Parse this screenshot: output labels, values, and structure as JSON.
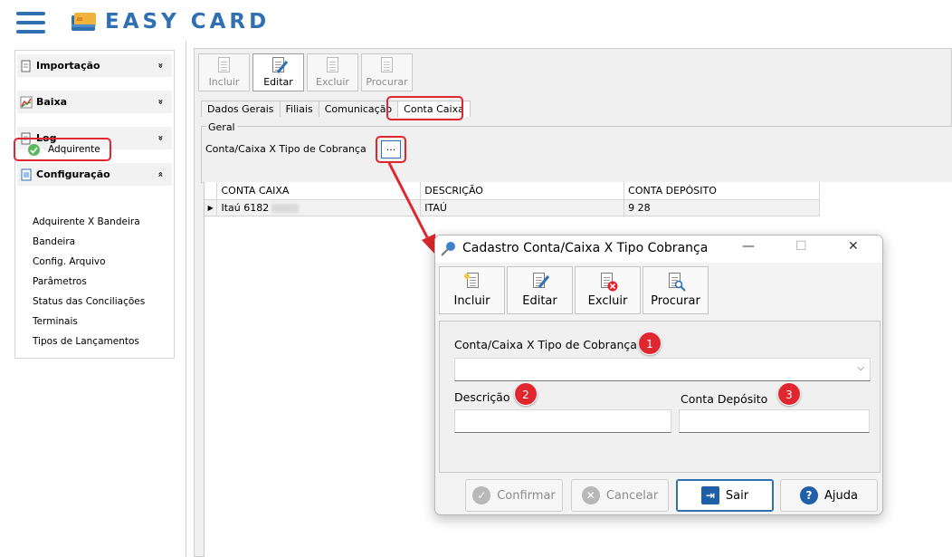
{
  "app": {
    "logo_text": "EASY CARD"
  },
  "sidebar": {
    "groups": [
      {
        "label": "Importação",
        "chevron": "»"
      },
      {
        "label": "Baixa",
        "chevron": "»"
      },
      {
        "label": "Log",
        "chevron": "»"
      },
      {
        "label": "Configuração",
        "chevron": "«"
      }
    ],
    "items": [
      {
        "label": "Adquirente"
      },
      {
        "label": "Adquirente X Bandeira"
      },
      {
        "label": "Bandeira"
      },
      {
        "label": "Config. Arquivo"
      },
      {
        "label": "Parâmetros"
      },
      {
        "label": "Status das Conciliações"
      },
      {
        "label": "Terminais"
      },
      {
        "label": "Tipos de Lançamentos"
      }
    ]
  },
  "toolbar": {
    "incluir": "Incluir",
    "editar": "Editar",
    "excluir": "Excluir",
    "procurar": "Procurar"
  },
  "tabs": [
    {
      "label": "Dados Gerais"
    },
    {
      "label": "Filiais"
    },
    {
      "label": "Comunicação"
    },
    {
      "label": "Conta Caixa"
    }
  ],
  "geral": {
    "legend": "Geral",
    "field_label": "Conta/Caixa X Tipo de Cobrança",
    "dots_label": "..."
  },
  "grid": {
    "columns": [
      "CONTA CAIXA",
      "DESCRIÇÃO",
      "CONTA DEPÓSITO"
    ],
    "rows": [
      {
        "indicator": "▶",
        "conta_caixa": "Itaú 6182",
        "descricao": "ITAÚ",
        "conta_deposito": "9   28"
      }
    ]
  },
  "dialog": {
    "title": "Cadastro Conta/Caixa X Tipo Cobrança",
    "minimize": "—",
    "maximize": "☐",
    "close": "✕",
    "toolbar": {
      "incluir": "Incluir",
      "editar": "Editar",
      "excluir": "Excluir",
      "procurar": "Procurar"
    },
    "fields": {
      "tipo_cobranca_label": "Conta/Caixa X Tipo de Cobrança",
      "descricao_label": "Descrição",
      "conta_deposito_label": "Conta Depósito"
    },
    "badges": [
      "1",
      "2",
      "3"
    ],
    "footer": {
      "confirmar": "Confirmar",
      "cancelar": "Cancelar",
      "sair": "Sair",
      "ajuda": "Ajuda"
    }
  },
  "colors": {
    "brand_blue": "#2f6fb2",
    "highlight_red": "#e0262e",
    "success_green": "#5bb85b"
  }
}
